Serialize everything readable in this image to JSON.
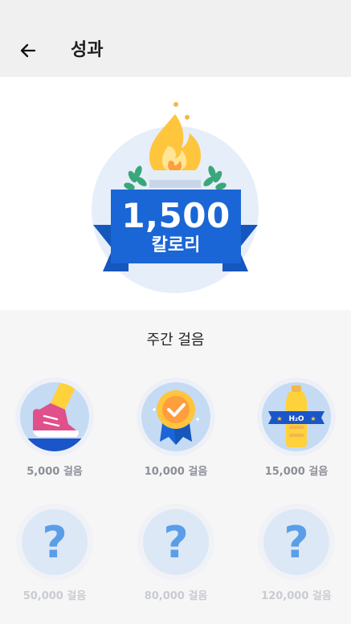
{
  "header": {
    "title": "성과"
  },
  "hero": {
    "value": "1,500",
    "unit": "칼로리"
  },
  "section": {
    "title": "주간 걸음"
  },
  "badges": [
    {
      "label": "5,000 걸음",
      "icon": "sneaker-icon",
      "unlocked": true
    },
    {
      "label": "10,000 걸음",
      "icon": "medal-icon",
      "unlocked": true
    },
    {
      "label": "15,000 걸음",
      "icon": "water-bottle-icon",
      "unlocked": true
    },
    {
      "label": "50,000 걸음",
      "icon": "question-mark-icon",
      "unlocked": false,
      "symbol": "?"
    },
    {
      "label": "80,000 걸음",
      "icon": "question-mark-icon",
      "unlocked": false,
      "symbol": "?"
    },
    {
      "label": "120,000 걸음",
      "icon": "question-mark-icon",
      "unlocked": false,
      "symbol": "?"
    }
  ],
  "colors": {
    "primary_blue": "#1a66d6",
    "ribbon_dark": "#1557bd",
    "flame": "#ffc53d"
  }
}
